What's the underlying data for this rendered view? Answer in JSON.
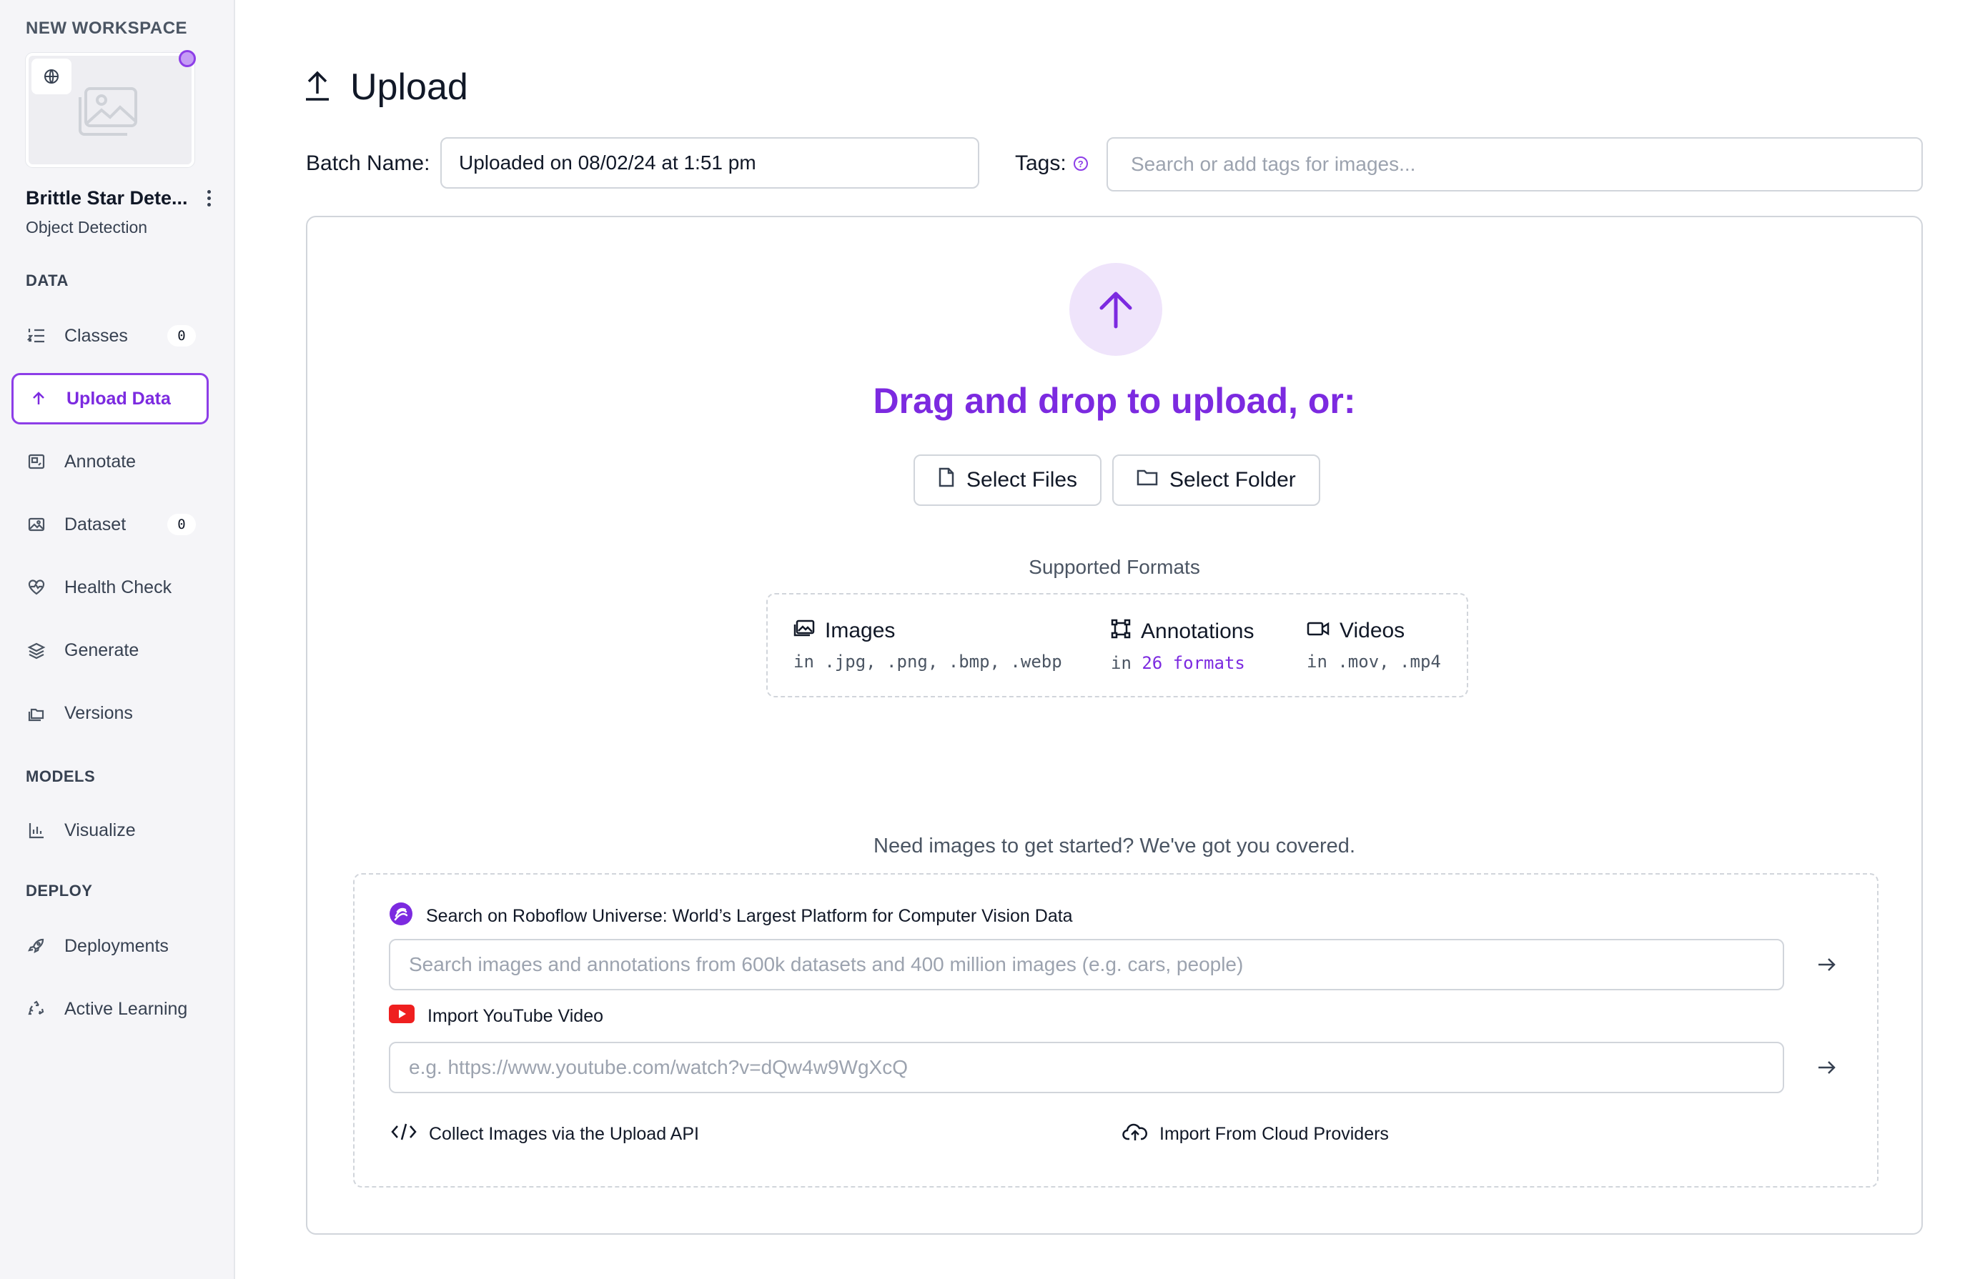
{
  "sidebar": {
    "workspace_label": "NEW WORKSPACE",
    "project_name": "Brittle Star Dete...",
    "project_type": "Object Detection",
    "sections": {
      "data": "DATA",
      "models": "MODELS",
      "deploy": "DEPLOY"
    },
    "items": {
      "classes": {
        "label": "Classes",
        "badge": "0"
      },
      "upload": {
        "label": "Upload Data"
      },
      "annotate": {
        "label": "Annotate"
      },
      "dataset": {
        "label": "Dataset",
        "badge": "0"
      },
      "health": {
        "label": "Health Check"
      },
      "generate": {
        "label": "Generate"
      },
      "versions": {
        "label": "Versions"
      },
      "visualize": {
        "label": "Visualize"
      },
      "deployments": {
        "label": "Deployments"
      },
      "active_learning": {
        "label": "Active Learning"
      }
    }
  },
  "header": {
    "title": "Upload",
    "batch_label": "Batch Name:",
    "batch_value": "Uploaded on 08/02/24 at 1:51 pm",
    "tags_label": "Tags:",
    "tags_placeholder": "Search or add tags for images..."
  },
  "dropzone": {
    "headline": "Drag and drop to upload, or:",
    "select_files": "Select Files",
    "select_folder": "Select Folder",
    "formats_title": "Supported Formats",
    "formats": {
      "images": {
        "title": "Images",
        "desc": "in .jpg, .png, .bmp, .webp"
      },
      "annotations": {
        "title": "Annotations",
        "prefix": "in",
        "link": "26 formats"
      },
      "videos": {
        "title": "Videos",
        "desc": "in .mov, .mp4"
      }
    }
  },
  "resources": {
    "intro": "Need images to get started? We've got you covered.",
    "universe_label": "Search on Roboflow Universe: World’s Largest Platform for Computer Vision Data",
    "universe_placeholder": "Search images and annotations from 600k datasets and 400 million images (e.g. cars, people)",
    "youtube_label": "Import YouTube Video",
    "youtube_placeholder": "e.g. https://www.youtube.com/watch?v=dQw4w9WgXcQ",
    "api_link": "Collect Images via the Upload API",
    "cloud_link": "Import From Cloud Providers"
  },
  "colors": {
    "accent": "#7c2ae0",
    "youtube": "#ef1f1f"
  }
}
